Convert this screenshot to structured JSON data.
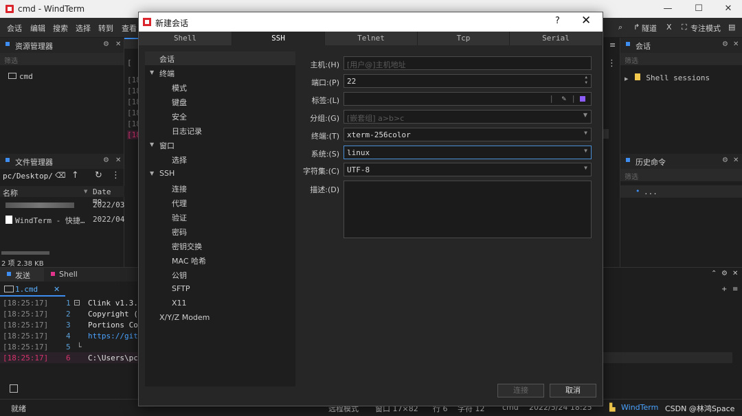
{
  "window": {
    "title": "cmd - WindTerm",
    "minimize": "—",
    "maximize": "☐",
    "close": "✕"
  },
  "menu": [
    "会话",
    "编辑",
    "搜索",
    "选择",
    "转到",
    "查看"
  ],
  "toolbar": {
    "tunnel": "隧道",
    "focus_mode": "专注模式"
  },
  "resource_manager": {
    "title": "资源管理器",
    "filter": "筛选",
    "items": [
      "cmd"
    ]
  },
  "file_manager": {
    "title": "文件管理器",
    "path": "pc/Desktop/",
    "col_name": "名称",
    "col_date": "Date mo",
    "rows": [
      {
        "name": "",
        "date": "2022/03"
      },
      {
        "name": "WindTerm - 快捷…",
        "date": "2022/04"
      }
    ],
    "summary": "2 项 2.38 KB"
  },
  "session_panel": {
    "title": "会话",
    "filter": "筛选",
    "items": [
      "Shell sessions"
    ]
  },
  "history_panel": {
    "title": "历史命令",
    "filter": "筛选",
    "items": [
      "..."
    ]
  },
  "bottom_tabs": {
    "send": "发送",
    "shell": "Shell"
  },
  "terminal_tab": "1.cmd",
  "terminal_lines": [
    {
      "time": "[18:25:17]",
      "num": "1",
      "text": "Clink v1.3."
    },
    {
      "time": "[18:25:17]",
      "num": "2",
      "text": "Copyright ("
    },
    {
      "time": "[18:25:17]",
      "num": "3",
      "text": "Portions Co"
    },
    {
      "time": "[18:25:17]",
      "num": "4",
      "text": "https://git"
    },
    {
      "time": "[18:25:17]",
      "num": "5",
      "text": ""
    },
    {
      "time": "[18:25:17]",
      "num": "6",
      "text": "C:\\Users\\pc"
    }
  ],
  "middle_lines": [
    "[18",
    "[18",
    "[18",
    "[18",
    "[18",
    "[18"
  ],
  "dialog": {
    "title": "新建会话",
    "help": "?",
    "close": "✕",
    "tabs": [
      "Shell",
      "SSH",
      "Telnet",
      "Tcp",
      "Serial"
    ],
    "active_tab": "SSH",
    "tree": [
      {
        "label": "会话",
        "level": 0,
        "selected": true
      },
      {
        "label": "终端",
        "level": 0,
        "caret": true
      },
      {
        "label": "模式",
        "level": 1
      },
      {
        "label": "键盘",
        "level": 1
      },
      {
        "label": "安全",
        "level": 1
      },
      {
        "label": "日志记录",
        "level": 1
      },
      {
        "label": "窗口",
        "level": 0,
        "caret": true
      },
      {
        "label": "选择",
        "level": 1
      },
      {
        "label": "SSH",
        "level": 0,
        "caret": true
      },
      {
        "label": "连接",
        "level": 1
      },
      {
        "label": "代理",
        "level": 1
      },
      {
        "label": "验证",
        "level": 1
      },
      {
        "label": "密码",
        "level": 1
      },
      {
        "label": "密钥交换",
        "level": 1
      },
      {
        "label": "MAC 哈希",
        "level": 1
      },
      {
        "label": "公钥",
        "level": 1
      },
      {
        "label": "SFTP",
        "level": 1
      },
      {
        "label": "X11",
        "level": 1
      },
      {
        "label": "X/Y/Z Modem",
        "level": 0
      }
    ],
    "fields": {
      "host": {
        "label": "主机:(H)",
        "value": "",
        "placeholder": "[用户@]主机地址"
      },
      "port": {
        "label": "端口:(P)",
        "value": "22"
      },
      "tag": {
        "label": "标签:(L)",
        "value": ""
      },
      "group": {
        "label": "分组:(G)",
        "value": "",
        "placeholder": "[嵌套组] a>b>c"
      },
      "terminal": {
        "label": "终端:(T)",
        "value": "xterm-256color"
      },
      "system": {
        "label": "系统:(S)",
        "value": "linux"
      },
      "charset": {
        "label": "字符集:(C)",
        "value": "UTF-8"
      },
      "desc": {
        "label": "描述:(D)",
        "value": ""
      }
    },
    "connect": "连接",
    "cancel": "取消"
  },
  "status": {
    "ready": "就绪",
    "mode": "远程模式",
    "window": "窗口 17×82",
    "row": "行 6",
    "col": "字符 12",
    "shell": "cmd",
    "datetime": "2022/5/24 18:25",
    "brand": "WindTerm",
    "watermark": "CSDN @林鸿Space"
  },
  "colors": {
    "accent": "#3d8ef0",
    "pink": "#e0358a",
    "timestamp_active": "#d6336c"
  }
}
